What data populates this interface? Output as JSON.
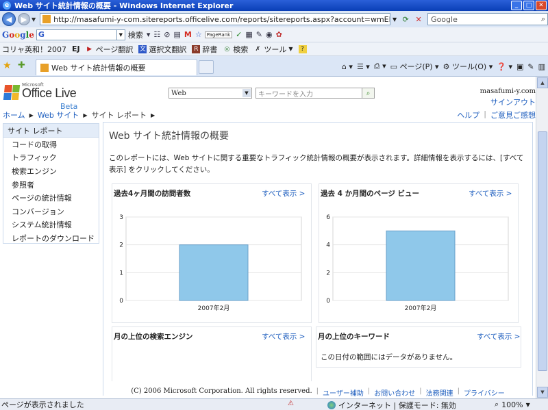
{
  "window": {
    "title": "Web サイト統計情報の概要 - Windows Internet Explorer",
    "ie_icon": "e"
  },
  "address_bar": {
    "url": "http://masafumi-y-com.sitereports.officelive.com/reports/sitereports.aspx?account=wmEBCAAAAAAA",
    "search_placeholder": "Google"
  },
  "google_toolbar": {
    "logo": [
      "G",
      "o",
      "o",
      "g",
      "l",
      "e"
    ],
    "search_value": "G",
    "search_button": "検索",
    "pagerank": "PageRank"
  },
  "links_toolbar": {
    "items": [
      "コリャ英和！2007",
      "EJ",
      "ページ翻訳",
      "選択文翻訳",
      "辞書",
      "検索",
      "ツール"
    ]
  },
  "tabs": {
    "active_title": "Web サイト統計情報の概要"
  },
  "command_bar": {
    "page_label": "ページ(P)",
    "tools_label": "ツール(O)"
  },
  "site": {
    "logo_small": "Microsoft",
    "logo_name": "Office Live",
    "logo_beta": "Beta",
    "search_scope": "Web",
    "search_placeholder": "キーワードを入力",
    "username": "masafumi-y.com",
    "signout": "サインアウト",
    "breadcrumb": [
      "ホーム",
      "Web サイト",
      "サイト レポート"
    ],
    "help": "ヘルプ",
    "feedback": "ご意見ご感想"
  },
  "sidenav": {
    "header": "サイト レポート",
    "items": [
      "コードの取得",
      "トラフィック",
      "検索エンジン",
      "参照者",
      "ページの統計情報",
      "コンバージョン",
      "システム統計情報",
      "レポートのダウンロード"
    ]
  },
  "main": {
    "title": "Web サイト統計情報の概要",
    "description": "このレポートには、Web サイトに関する重要なトラフィック統計情報の概要が表示されます。詳細情報を表示するには、[すべて表示] をクリックしてください。",
    "show_all": "すべて表示 >",
    "panels": {
      "visitors": {
        "title": "過去4ヶ月間の訪問者数"
      },
      "pageviews": {
        "title": "過去 4 か月間のページ ビュー"
      },
      "search_engines": {
        "title": "月の上位の検索エンジン"
      },
      "keywords": {
        "title": "月の上位のキーワード",
        "nodata": "この日付の範囲にはデータがありません。"
      }
    }
  },
  "chart_data": [
    {
      "type": "bar",
      "title": "過去4ヶ月間の訪問者数",
      "categories": [
        "2007年2月"
      ],
      "values": [
        2
      ],
      "ylim": [
        0,
        3
      ],
      "yticks": [
        0,
        1,
        2,
        3
      ],
      "grid": true,
      "color": "#8fc8ea"
    },
    {
      "type": "bar",
      "title": "過去 4 か月間のページ ビュー",
      "categories": [
        "2007年2月"
      ],
      "values": [
        5
      ],
      "ylim": [
        0,
        6
      ],
      "yticks": [
        0,
        2,
        4,
        6
      ],
      "grid": true,
      "color": "#8fc8ea"
    }
  ],
  "footer": {
    "copyright": "(C) 2006 Microsoft Corporation. All rights reserved.",
    "links": [
      "ユーザー補助",
      "お問い合わせ",
      "法務関連",
      "プライバシー"
    ]
  },
  "statusbar": {
    "message": "ページが表示されました",
    "zone": "インターネット | 保護モード: 無効",
    "zoom": "100%"
  }
}
